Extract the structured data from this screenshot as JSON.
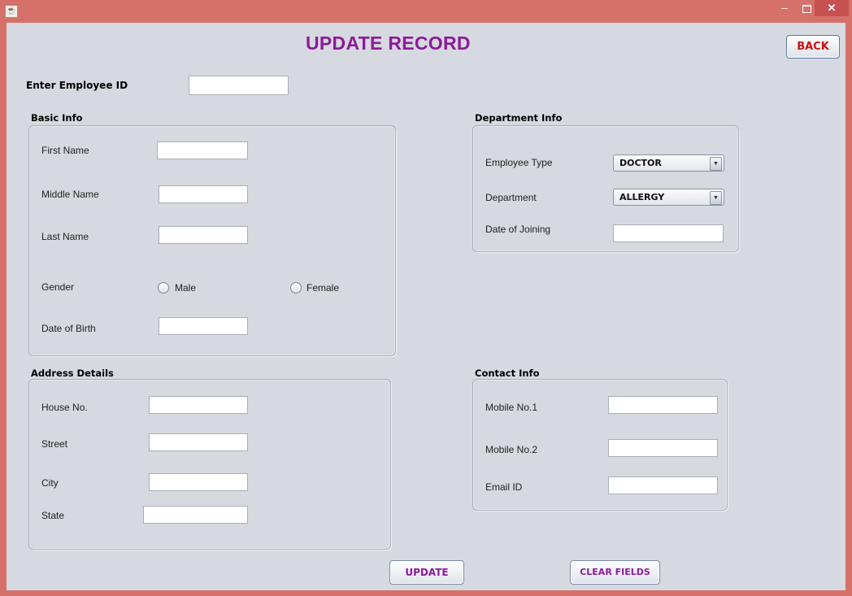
{
  "window": {
    "app_icon": "java-cup-icon",
    "minimize": "‒",
    "close": "✕"
  },
  "header": {
    "title": "UPDATE RECORD",
    "back_label": "BACK"
  },
  "employee_id": {
    "label": "Enter Employee ID",
    "value": ""
  },
  "basic_info": {
    "title": "Basic Info",
    "first_name": {
      "label": "First Name",
      "value": ""
    },
    "middle_name": {
      "label": "Middle Name",
      "value": ""
    },
    "last_name": {
      "label": "Last Name",
      "value": ""
    },
    "gender": {
      "label": "Gender",
      "options": [
        "Male",
        "Female"
      ],
      "selected": null
    },
    "dob": {
      "label": "Date of Birth",
      "value": ""
    }
  },
  "department_info": {
    "title": "Department Info",
    "employee_type": {
      "label": "Employee Type",
      "value": "DOCTOR"
    },
    "department": {
      "label": "Department",
      "value": "ALLERGY"
    },
    "date_of_joining": {
      "label": "Date of Joining",
      "value": ""
    }
  },
  "address_details": {
    "title": "Address Details",
    "house_no": {
      "label": "House No.",
      "value": ""
    },
    "street": {
      "label": "Street",
      "value": ""
    },
    "city": {
      "label": "City",
      "value": ""
    },
    "state": {
      "label": "State",
      "value": ""
    }
  },
  "contact_info": {
    "title": "Contact Info",
    "mobile1": {
      "label": "Mobile No.1",
      "value": ""
    },
    "mobile2": {
      "label": "Mobile No.2",
      "value": ""
    },
    "email": {
      "label": "Email ID",
      "value": ""
    }
  },
  "actions": {
    "update_label": "UPDATE",
    "clear_label": "CLEAR FIELDS"
  },
  "colors": {
    "title": "#8c1a9b",
    "back": "#cc1111",
    "frame": "#d5716a",
    "content_bg": "#d6d9df"
  }
}
